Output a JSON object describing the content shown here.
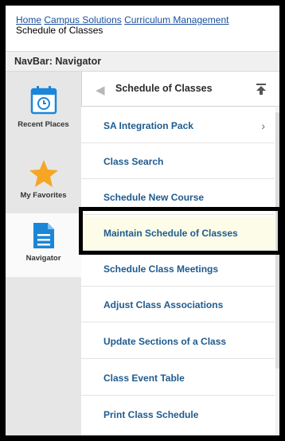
{
  "breadcrumb": {
    "home": "Home",
    "campus_solutions": "Campus Solutions",
    "curriculum_management": "Curriculum Management",
    "current": "Schedule of Classes"
  },
  "navbar": {
    "title": "NavBar: Navigator"
  },
  "rail": {
    "items": [
      {
        "label": "Recent Places",
        "icon": "calendar-clock-icon"
      },
      {
        "label": "My Favorites",
        "icon": "star-icon"
      },
      {
        "label": "Navigator",
        "icon": "document-icon"
      }
    ]
  },
  "panel": {
    "title": "Schedule of Classes",
    "items": [
      {
        "label": "SA Integration Pack",
        "has_children": true
      },
      {
        "label": "Class Search"
      },
      {
        "label": "Schedule New Course"
      },
      {
        "label": "Maintain Schedule of Classes"
      },
      {
        "label": "Schedule Class Meetings"
      },
      {
        "label": "Adjust Class Associations"
      },
      {
        "label": "Update Sections of a Class"
      },
      {
        "label": "Class Event Table"
      },
      {
        "label": "Print Class Schedule"
      }
    ]
  },
  "colors": {
    "link": "#1a4f9e",
    "menu_text": "#1e5b8e",
    "star": "#f5a623",
    "icon_blue": "#1b86d8",
    "selected_bg": "#fcfce8"
  }
}
